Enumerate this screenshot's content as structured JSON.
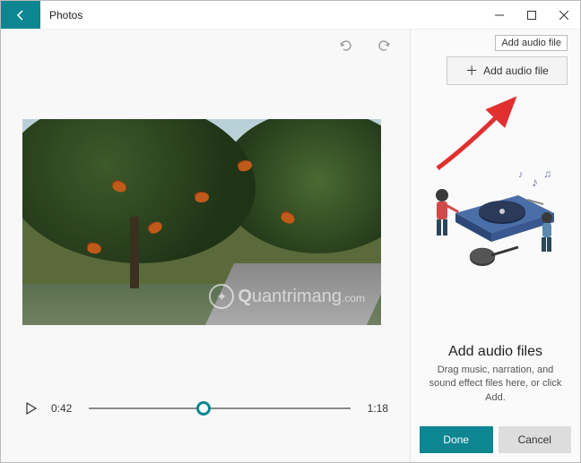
{
  "titlebar": {
    "app_name": "Photos"
  },
  "controls": {
    "current_time": "0:42",
    "total_time": "1:18",
    "progress_pct": 44
  },
  "watermark": {
    "brand_q": "Q",
    "brand_rest": "uantrimang",
    "brand_dot": ".com"
  },
  "sidepanel": {
    "tooltip": "Add audio file",
    "add_button": "Add audio file",
    "heading": "Add audio files",
    "description": "Drag music, narration, and sound effect files here, or click Add.",
    "done": "Done",
    "cancel": "Cancel"
  },
  "colors": {
    "accent": "#0d8691",
    "arrow": "#e03030"
  }
}
